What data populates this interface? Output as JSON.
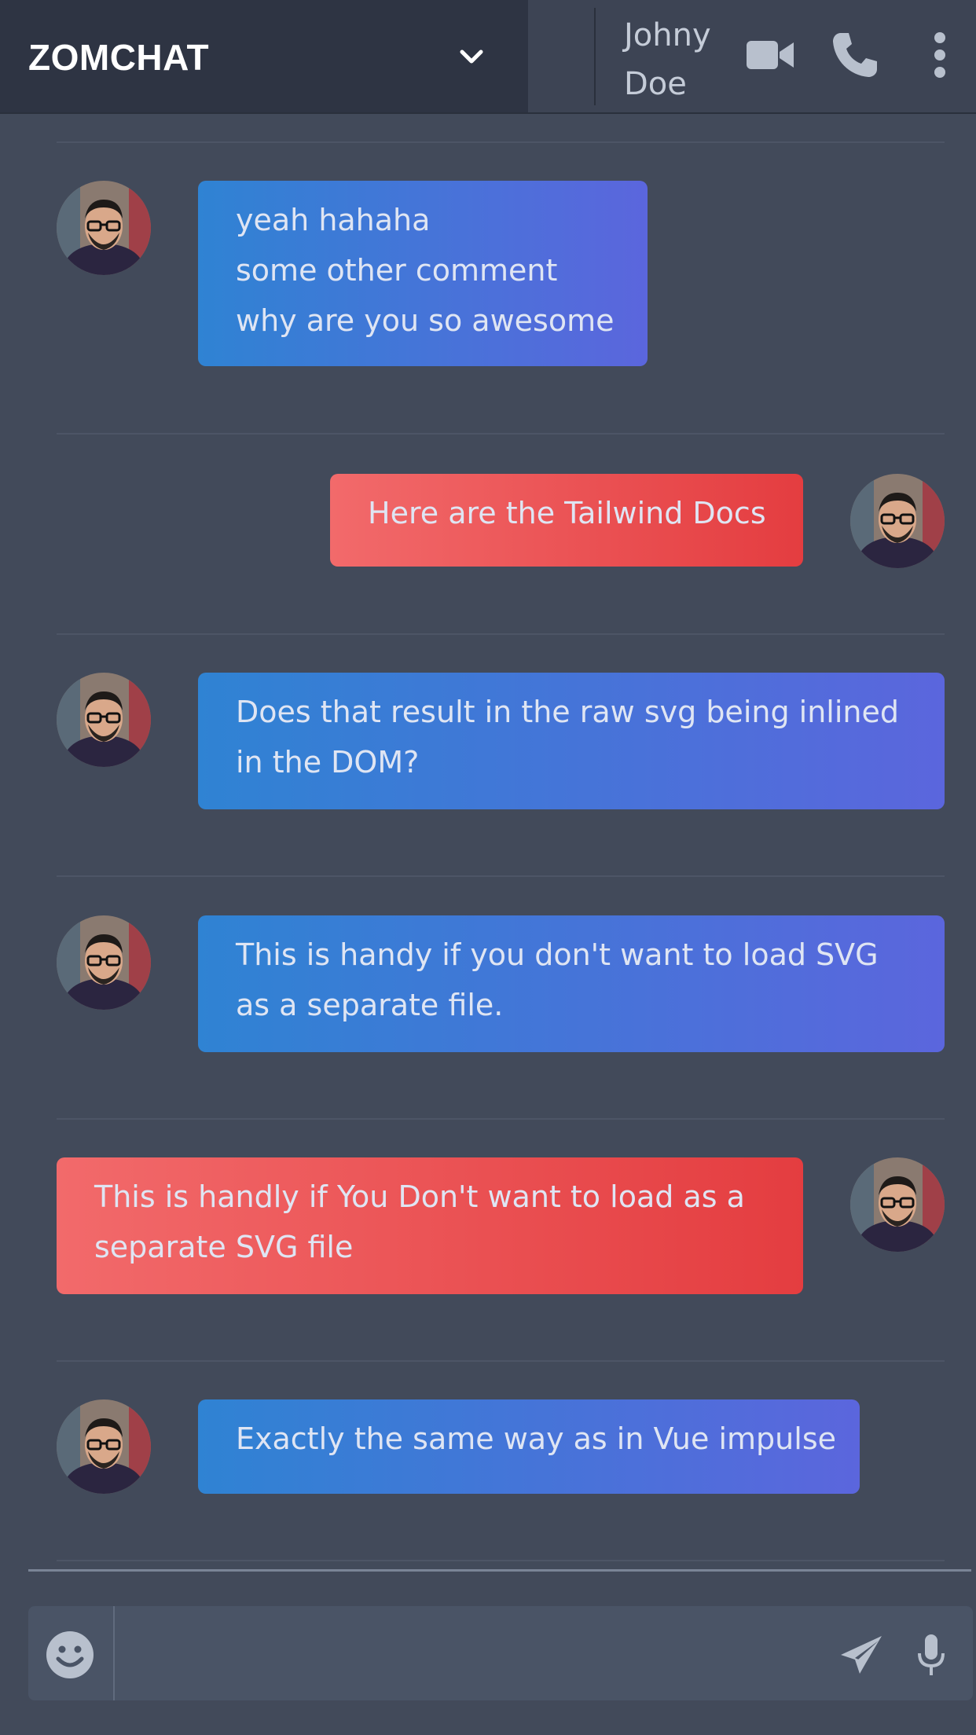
{
  "header": {
    "brand": "ZOMCHAT",
    "contact_first": "Johny",
    "contact_last": "Doe"
  },
  "messages": [
    {
      "side": "left",
      "color": "blue",
      "lines": [
        "yeah hahaha",
        "some other comment",
        "why are you so awesome"
      ]
    },
    {
      "side": "right",
      "color": "red",
      "lines": [
        "Here are the Tailwind Docs"
      ]
    },
    {
      "side": "left",
      "color": "blue",
      "lines": [
        "Does that result in the raw svg being inlined",
        "in the DOM?"
      ]
    },
    {
      "side": "left",
      "color": "blue",
      "lines": [
        "This is handy if you don't want to load SVG",
        "as a separate file."
      ]
    },
    {
      "side": "right",
      "color": "red",
      "lines": [
        "This is handly if You Don't want to load as a",
        "separate SVG file"
      ]
    },
    {
      "side": "left",
      "color": "blue",
      "lines": [
        "Exactly the same way as in Vue impulse"
      ]
    }
  ],
  "composer": {
    "value": "",
    "placeholder": ""
  },
  "colors": {
    "accent_blue": "#2f83d3",
    "accent_red": "#e43d40",
    "background": "#424a5a"
  }
}
